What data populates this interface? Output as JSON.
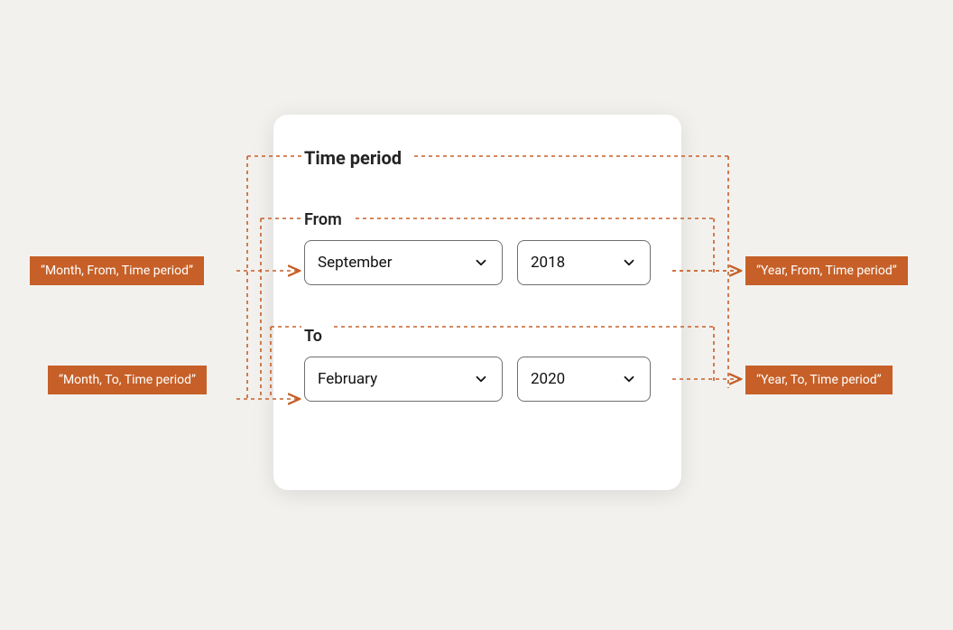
{
  "card": {
    "title": "Time period",
    "from": {
      "label": "From",
      "month": "September",
      "year": "2018"
    },
    "to": {
      "label": "To",
      "month": "February",
      "year": "2020"
    }
  },
  "annotations": {
    "month_from": "“Month, From, Time period”",
    "month_to": "“Month, To, Time period”",
    "year_from": "“Year, From, Time period”",
    "year_to": "“Year, To, Time period”"
  },
  "colors": {
    "accent": "#c66028",
    "dash": "#c66028"
  }
}
